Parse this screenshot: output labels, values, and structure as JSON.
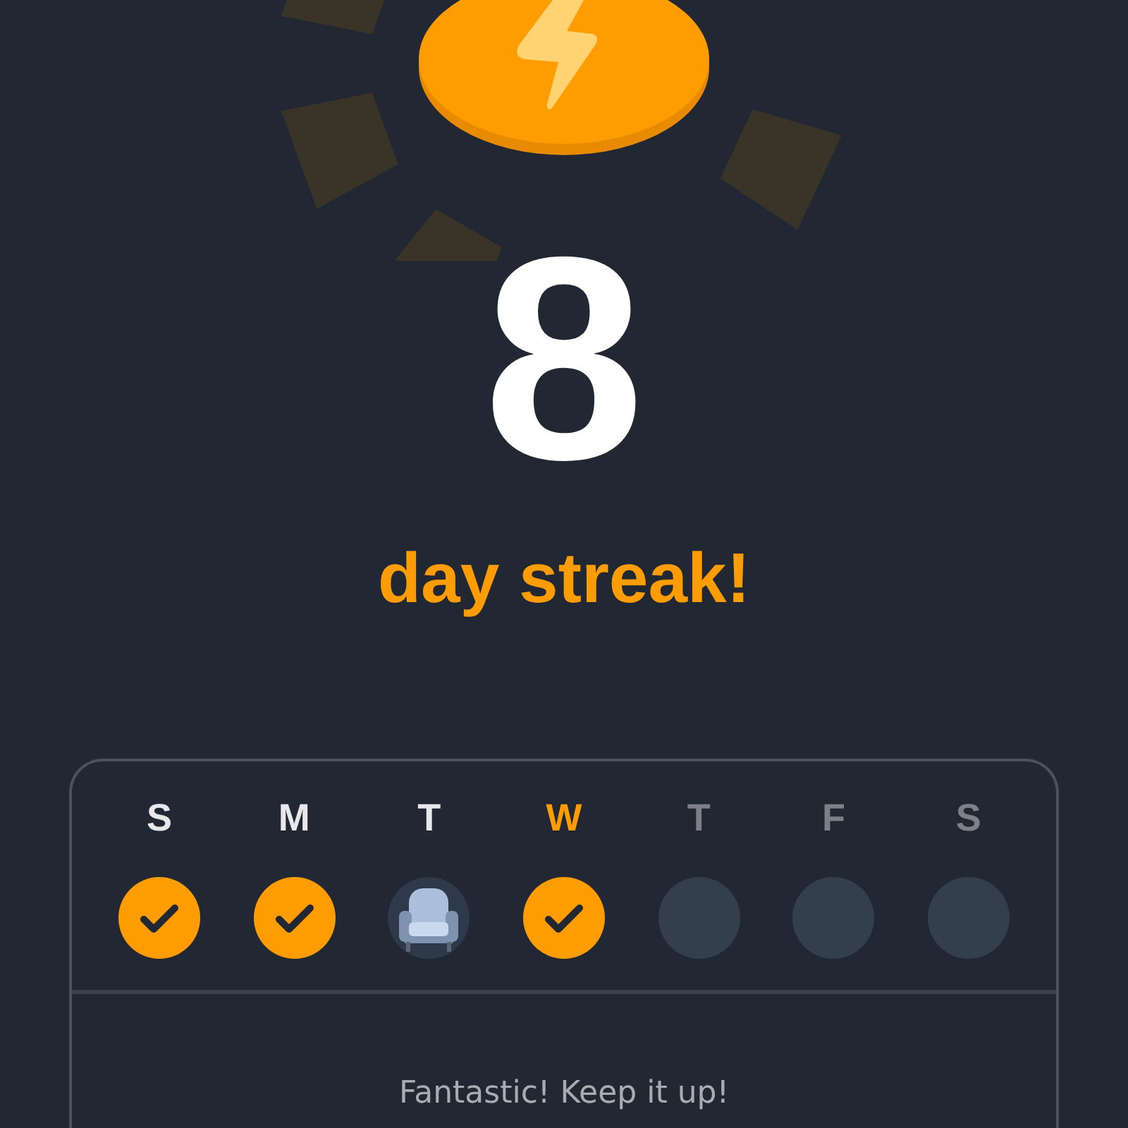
{
  "streak": {
    "count": "8",
    "label": "day streak!"
  },
  "days": [
    {
      "label": "S",
      "kind": "done",
      "selected": false
    },
    {
      "label": "M",
      "kind": "done",
      "selected": false
    },
    {
      "label": "T",
      "kind": "freeze",
      "selected": false
    },
    {
      "label": "W",
      "kind": "done",
      "selected": true
    },
    {
      "label": "T",
      "kind": "none",
      "selected": false
    },
    {
      "label": "F",
      "kind": "none",
      "selected": false
    },
    {
      "label": "S",
      "kind": "none",
      "selected": false
    }
  ],
  "message": "Fantastic! Keep it up!"
}
